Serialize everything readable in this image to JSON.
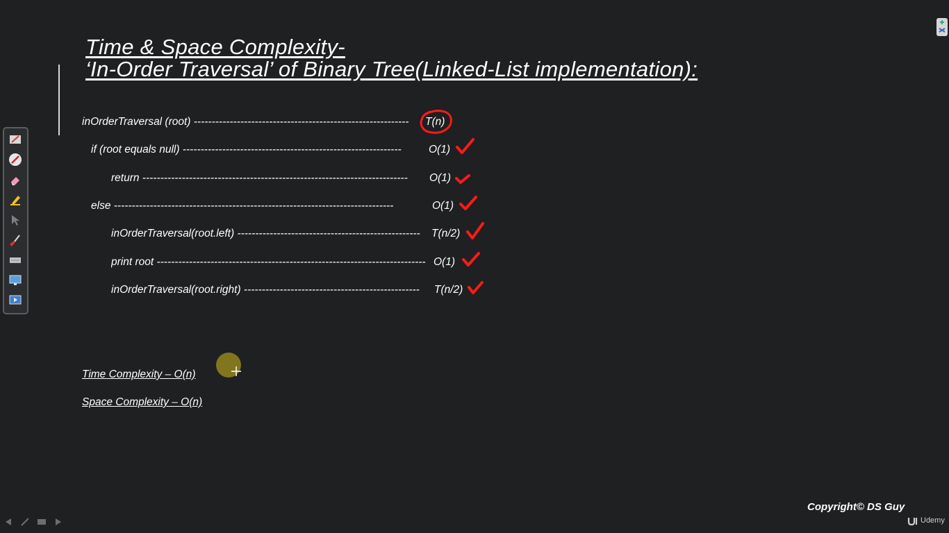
{
  "slide": {
    "title_line1": "Time & Space Complexity-",
    "title_line2": "‘In-Order Traversal’ of Binary Tree(Linked-List implementation):"
  },
  "code_lines": [
    {
      "text": "inOrderTraversal (root) ------------------------------------------------------------",
      "cost": "T(n)",
      "annotation": "circled"
    },
    {
      "text": "if (root equals null) -------------------------------------------------------------",
      "cost": "O(1)",
      "annotation": "check"
    },
    {
      "text": "return --------------------------------------------------------------------------",
      "cost": "O(1)",
      "annotation": "check"
    },
    {
      "text": "else ------------------------------------------------------------------------------",
      "cost": "O(1)",
      "annotation": "check"
    },
    {
      "text": "inOrderTraversal(root.left) ---------------------------------------------------",
      "cost": "T(n/2)",
      "annotation": "check"
    },
    {
      "text": "print root ---------------------------------------------------------------------------",
      "cost": "O(1)",
      "annotation": "check"
    },
    {
      "text": "inOrderTraversal(root.right) -------------------------------------------------",
      "cost": "T(n/2)",
      "annotation": "check"
    }
  ],
  "summary": {
    "time": "Time Complexity – O(n)",
    "space": "Space Complexity – O(n)"
  },
  "footer": {
    "copyright": "Copyright© DS Guy",
    "brand": "Udemy"
  },
  "colors": {
    "background": "#1f2021",
    "text": "#ffffff",
    "annotation": "#ff1a1a",
    "cursor_highlight": "#8a7d1e"
  },
  "toolbar": {
    "tools": [
      "pen-icon",
      "laser-pointer-icon",
      "eraser-icon",
      "highlighter-icon",
      "arrow-cursor-icon",
      "brush-icon",
      "keyboard-icon",
      "screen-icon",
      "slideshow-icon"
    ]
  }
}
